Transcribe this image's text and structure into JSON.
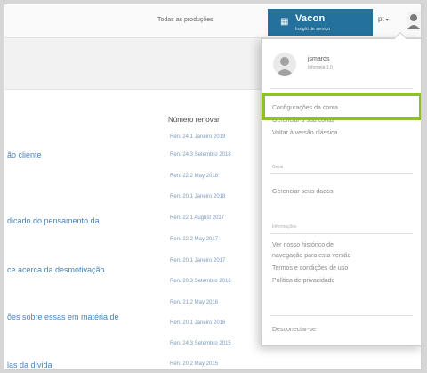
{
  "header": {
    "top_link": "Todas as produções",
    "brand_name": "Vacon",
    "brand_sub": "Insight de serviço",
    "language": "pt"
  },
  "left_links": [
    "ão cliente",
    "",
    "dicado do pensamento da",
    "",
    "ce acerca da desmotivação",
    "",
    "ões sobre essas em matéria de",
    "",
    "las da dívida"
  ],
  "date_column": {
    "header": "Número renovar",
    "dates": [
      "Ren. 24.1 Janeiro 2019",
      "Ren. 24.3 Setembro 2018",
      "Ren. 22.2 May 2018",
      "Ren. 20.1 Janeiro 2018",
      "Ren. 22.1 August 2017",
      "Ren. 22.2 May 2017",
      "Ren. 20.1 Janeiro 2017",
      "Ren. 20.3 Setembro 2016",
      "Ren. 21.2 May 2016",
      "Ren. 20.1 Janeiro 2016",
      "Ren. 24.3 Setembro 2015",
      "Ren. 20.2 May 2015"
    ]
  },
  "dropdown": {
    "profile_name": "jsmards",
    "profile_sub": "Infometa 1.0",
    "menu_group_1": [
      "Configurações da conta",
      "Gerenciar a sua conta",
      "Voltar à versão clássica"
    ],
    "heading_2": "Geral",
    "menu_group_2": [
      "Gerenciar seus dados"
    ],
    "heading_3": "Informações",
    "menu_group_3": [
      "Ver nosso histórico de",
      "navegação para esta versão",
      "Termos e condições de uso",
      "Política de privacidade"
    ],
    "logout": "Desconectar-se",
    "highlighted_item": "Configurações da conta"
  },
  "colors": {
    "brand": "#24719d",
    "highlight": "#8fbf2a",
    "link": "#4a83b5"
  }
}
